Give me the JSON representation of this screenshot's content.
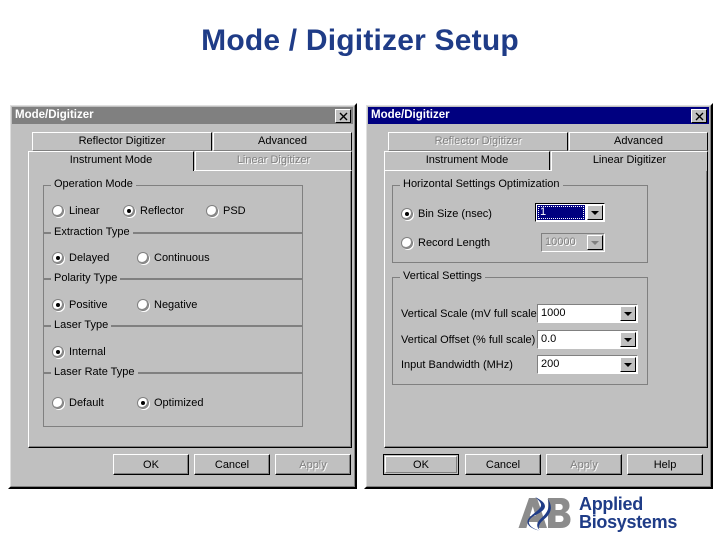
{
  "slide": {
    "title": "Mode / Digitizer Setup",
    "title_color": "#1F3C87"
  },
  "logo": {
    "mark_text": "AB",
    "line1": "Applied",
    "line2": "Biosystems",
    "mark_color": "#8C8C8C",
    "text_color": "#1F3C87"
  },
  "left_dialog": {
    "title": "Mode/Digitizer",
    "active": false,
    "close_label": "×",
    "tabs": [
      {
        "label": "Reflector Digitizer",
        "row": "top",
        "state": "normal"
      },
      {
        "label": "Advanced",
        "row": "top",
        "state": "normal"
      },
      {
        "label": "Instrument Mode",
        "row": "bottom",
        "state": "selected"
      },
      {
        "label": "Linear Digitizer",
        "row": "bottom",
        "state": "disabled"
      }
    ],
    "groups": {
      "operation_mode": {
        "label": "Operation Mode",
        "options": [
          {
            "label": "Linear",
            "checked": false
          },
          {
            "label": "Reflector",
            "checked": true
          },
          {
            "label": "PSD",
            "checked": false
          }
        ]
      },
      "extraction_type": {
        "label": "Extraction Type",
        "options": [
          {
            "label": "Delayed",
            "checked": true
          },
          {
            "label": "Continuous",
            "checked": false
          }
        ]
      },
      "polarity_type": {
        "label": "Polarity Type",
        "options": [
          {
            "label": "Positive",
            "checked": true
          },
          {
            "label": "Negative",
            "checked": false
          }
        ]
      },
      "laser_type": {
        "label": "Laser Type",
        "options": [
          {
            "label": "Internal",
            "checked": true
          }
        ]
      },
      "laser_rate_type": {
        "label": "Laser Rate Type",
        "options": [
          {
            "label": "Default",
            "checked": false
          },
          {
            "label": "Optimized",
            "checked": true
          }
        ]
      }
    },
    "buttons": [
      {
        "label": "OK",
        "state": "normal"
      },
      {
        "label": "Cancel",
        "state": "normal"
      },
      {
        "label": "Apply",
        "state": "disabled"
      }
    ]
  },
  "right_dialog": {
    "title": "Mode/Digitizer",
    "active": true,
    "close_label": "×",
    "tabs": [
      {
        "label": "Reflector Digitizer",
        "row": "top",
        "state": "disabled"
      },
      {
        "label": "Advanced",
        "row": "top",
        "state": "normal"
      },
      {
        "label": "Instrument Mode",
        "row": "bottom",
        "state": "normal"
      },
      {
        "label": "Linear Digitizer",
        "row": "bottom",
        "state": "selected"
      }
    ],
    "groups": {
      "horizontal": {
        "label": "Horizontal Settings Optimization",
        "rows": [
          {
            "radio": "Bin Size (nsec)",
            "checked": true,
            "value": "1",
            "combo_state": "focused"
          },
          {
            "radio": "Record Length",
            "checked": false,
            "value": "10000",
            "combo_state": "disabled"
          }
        ]
      },
      "vertical": {
        "label": "Vertical Settings",
        "rows": [
          {
            "label": "Vertical Scale (mV full scale)",
            "value": "1000",
            "combo_state": "normal"
          },
          {
            "label": "Vertical Offset (% full scale)",
            "value": "0.0",
            "combo_state": "normal"
          },
          {
            "label": "Input Bandwidth (MHz)",
            "value": "200",
            "combo_state": "normal"
          }
        ]
      }
    },
    "buttons": [
      {
        "label": "OK",
        "state": "default"
      },
      {
        "label": "Cancel",
        "state": "normal"
      },
      {
        "label": "Apply",
        "state": "disabled"
      },
      {
        "label": "Help",
        "state": "normal"
      }
    ]
  }
}
